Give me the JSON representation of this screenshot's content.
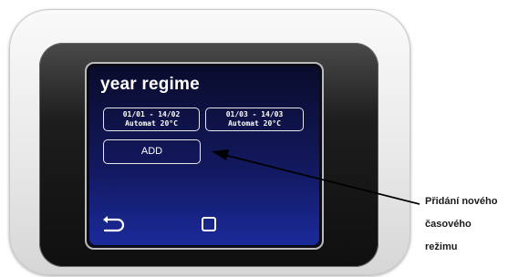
{
  "screen": {
    "title": "year regime",
    "schedules": [
      {
        "dates": "01/01 - 14/02",
        "mode_temp": "Automat  20°C"
      },
      {
        "dates": "01/03 - 14/03",
        "mode_temp": "Automat  20°C"
      }
    ],
    "add_label": "ADD",
    "nav": {
      "back_icon": "back-arrow-icon",
      "home_icon": "square-icon"
    }
  },
  "annotation": {
    "lines": [
      "Přidání nového",
      "časového",
      "režimu"
    ]
  },
  "colors": {
    "screen_top": "#0a0c2c",
    "screen_bottom": "#1a2a9a",
    "text": "#ffffff",
    "annotation_text": "#1a1a1a"
  }
}
